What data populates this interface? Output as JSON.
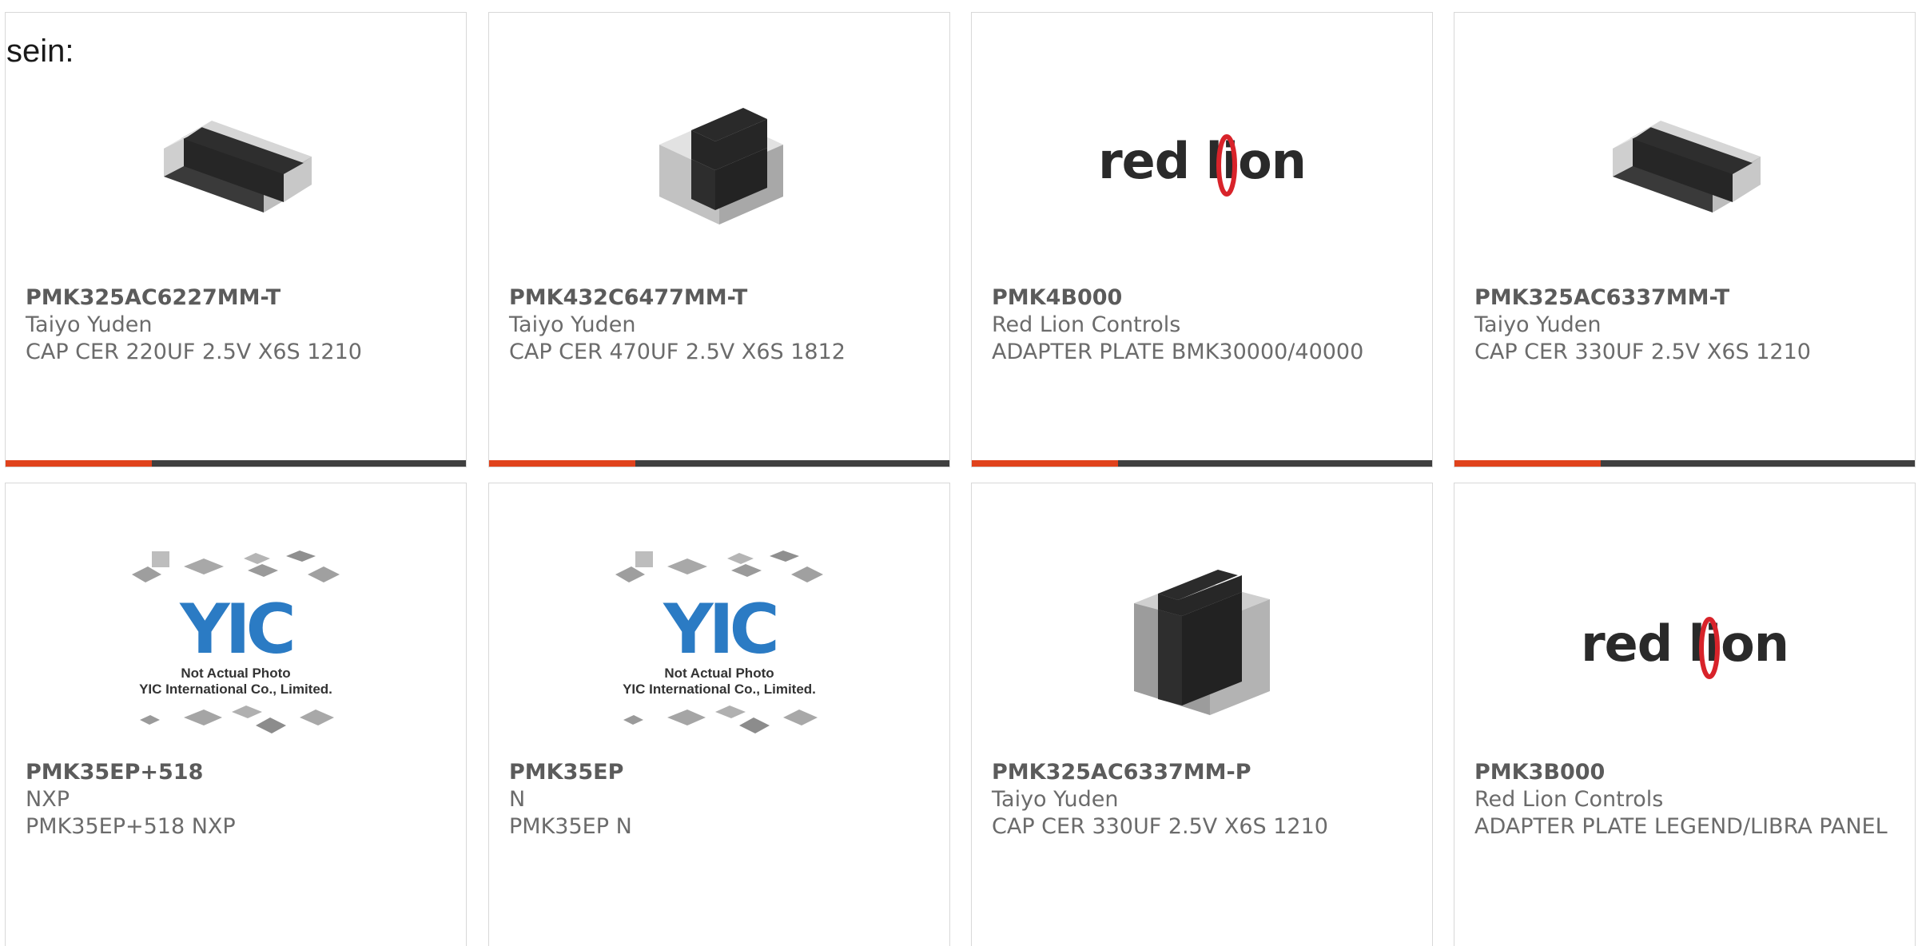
{
  "intro_text": "sein:",
  "products": [
    {
      "part_number": "PMK325AC6227MM-T",
      "manufacturer": "Taiyo Yuden",
      "description": "CAP CER 220UF 2.5V X6S 1210",
      "image": "chip-capacitor"
    },
    {
      "part_number": "PMK432C6477MM-T",
      "manufacturer": "Taiyo Yuden",
      "description": "CAP CER 470UF 2.5V X6S 1812",
      "image": "chip-capacitor"
    },
    {
      "part_number": "PMK4B000",
      "manufacturer": "Red Lion Controls",
      "description": "ADAPTER PLATE BMK30000/40000",
      "image": "red-lion-logo"
    },
    {
      "part_number": "PMK325AC6337MM-T",
      "manufacturer": "Taiyo Yuden",
      "description": "CAP CER 330UF 2.5V X6S 1210",
      "image": "chip-capacitor"
    },
    {
      "part_number": "PMK35EP+518",
      "manufacturer": "NXP",
      "description": "PMK35EP+518 NXP",
      "image": "yic-placeholder"
    },
    {
      "part_number": "PMK35EP",
      "manufacturer": "N",
      "description": "PMK35EP N",
      "image": "yic-placeholder"
    },
    {
      "part_number": "PMK325AC6337MM-P",
      "manufacturer": "Taiyo Yuden",
      "description": "CAP CER 330UF 2.5V X6S 1210",
      "image": "chip-capacitor"
    },
    {
      "part_number": "PMK3B000",
      "manufacturer": "Red Lion Controls",
      "description": "ADAPTER PLATE LEGEND/LIBRA PANEL",
      "image": "red-lion-logo"
    }
  ],
  "logo_text": {
    "red_lion": "red lion",
    "yic_word": "YIC",
    "yic_caption_1": "Not Actual Photo",
    "yic_caption_2": "YIC International Co., Limited."
  },
  "colors": {
    "accent": "#e0421c",
    "bar": "#3f3f3f",
    "text": "#6b6b6b",
    "border": "#d8d8d8"
  }
}
